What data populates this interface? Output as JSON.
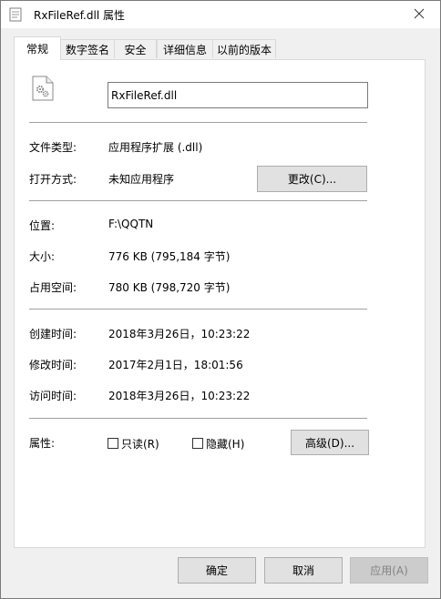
{
  "window": {
    "title": "RxFileRef.dll 属性",
    "app_icon": "file-properties-icon",
    "close_icon": "close-icon"
  },
  "tabs": [
    {
      "label": "常规",
      "active": true
    },
    {
      "label": "数字签名",
      "active": false
    },
    {
      "label": "安全",
      "active": false
    },
    {
      "label": "详细信息",
      "active": false
    },
    {
      "label": "以前的版本",
      "active": false
    }
  ],
  "general": {
    "file_icon": "dll-gear-file-icon",
    "file_name": "RxFileRef.dll",
    "type_label": "文件类型:",
    "type_value": "应用程序扩展 (.dll)",
    "opens_with_label": "打开方式:",
    "opens_with_value": "未知应用程序",
    "change_button": "更改(C)...",
    "location_label": "位置:",
    "location_value": "F:\\QQTN",
    "size_label": "大小:",
    "size_value": "776 KB (795,184 字节)",
    "size_on_disk_label": "占用空间:",
    "size_on_disk_value": "780 KB (798,720 字节)",
    "created_label": "创建时间:",
    "created_value": "2018年3月26日，10:23:22",
    "modified_label": "修改时间:",
    "modified_value": "2017年2月1日，18:01:56",
    "accessed_label": "访问时间:",
    "accessed_value": "2018年3月26日，10:23:22",
    "attributes_label": "属性:",
    "readonly_label": "只读(R)",
    "readonly_checked": false,
    "hidden_label": "隐藏(H)",
    "hidden_checked": false,
    "advanced_button": "高级(D)..."
  },
  "footer": {
    "ok_button": "确定",
    "cancel_button": "取消",
    "apply_button": "应用(A)"
  }
}
